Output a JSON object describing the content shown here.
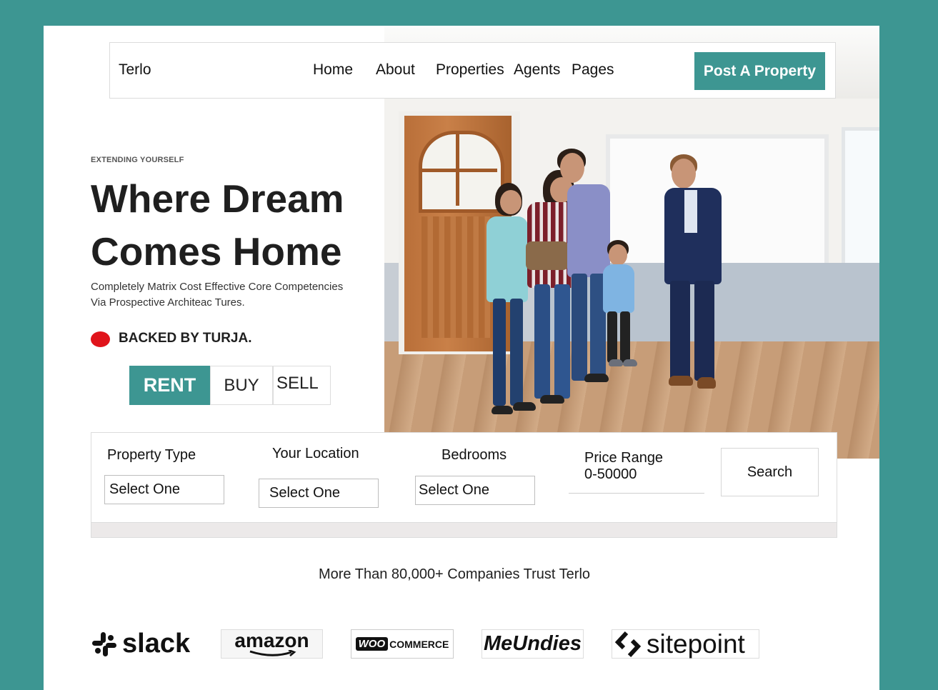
{
  "navbar": {
    "brand": "Terlo",
    "links": [
      "Home",
      "About",
      "Properties",
      "Agents",
      "Pages"
    ],
    "cta": "Post A Property"
  },
  "hero": {
    "eyebrow": "EXTENDING YOURSELF",
    "headline_line1": "Where Dream",
    "headline_line2": "Comes Home",
    "subtext_line1": "Completely Matrix Cost Effective Core Competencies",
    "subtext_line2": "Via Prospective Architeac Tures.",
    "backed": "BACKED BY TURJA."
  },
  "tabs": {
    "rent": "RENT",
    "buy": "BUY",
    "sell": "SELL",
    "active": "rent"
  },
  "search": {
    "property_type_label": "Property Type",
    "property_type_value": "Select One",
    "location_label": "Your Location",
    "location_value": "Select One",
    "bedrooms_label": "Bedrooms",
    "bedrooms_value": "Select One",
    "price_label": "Price Range",
    "price_value": "0-50000",
    "search_button": "Search"
  },
  "trust": {
    "text": "More Than 80,000+ Companies Trust Terlo",
    "logos": {
      "slack": "slack",
      "amazon": "amazon",
      "woo_badge": "WOO",
      "woo_text": "COMMERCE",
      "meundies": "MeUndies",
      "sitepoint": "sitepoint"
    }
  },
  "colors": {
    "brand": "#3d9692",
    "dot": "#e0141b"
  }
}
